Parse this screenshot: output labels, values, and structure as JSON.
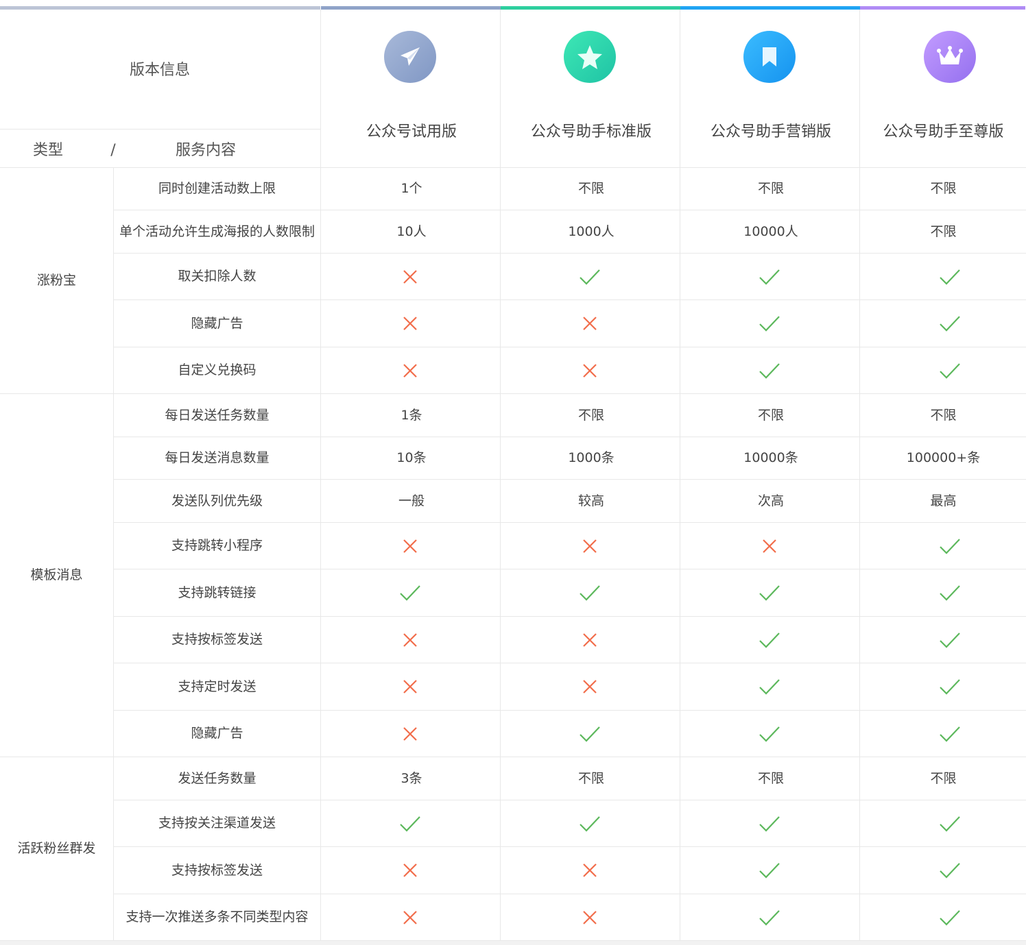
{
  "header": {
    "version_label": "版本信息",
    "type_label": "类型",
    "slash": "/",
    "service_label": "服务内容"
  },
  "plans": [
    {
      "name": "公众号试用版",
      "icon": "paper-plane-icon",
      "bar_color": "#8fa3c8",
      "icon_from": "#a8b9d9",
      "icon_to": "#8097c4"
    },
    {
      "name": "公众号助手标准版",
      "icon": "star-icon",
      "bar_color": "#2ecf9e",
      "icon_from": "#3ee8b5",
      "icon_to": "#1fc3a5"
    },
    {
      "name": "公众号助手营销版",
      "icon": "bookmark-icon",
      "bar_color": "#20a4f3",
      "icon_from": "#3bbcff",
      "icon_to": "#1593ef"
    },
    {
      "name": "公众号助手至尊版",
      "icon": "crown-icon",
      "bar_color": "#b08cf5",
      "icon_from": "#c39cff",
      "icon_to": "#9470ef"
    }
  ],
  "colors": {
    "check": "#5cb85c",
    "cross": "#f26d4b",
    "topbar_left": "#bcc4d6"
  },
  "groups": [
    {
      "name": "涨粉宝",
      "rows": [
        {
          "feature": "同时创建活动数上限",
          "values": [
            "1个",
            "不限",
            "不限",
            "不限"
          ]
        },
        {
          "feature": "单个活动允许生成海报的人数限制",
          "values": [
            "10人",
            "1000人",
            "10000人",
            "不限"
          ]
        },
        {
          "feature": "取关扣除人数",
          "values": [
            "x",
            "v",
            "v",
            "v"
          ]
        },
        {
          "feature": "隐藏广告",
          "values": [
            "x",
            "x",
            "v",
            "v"
          ]
        },
        {
          "feature": "自定义兑换码",
          "values": [
            "x",
            "x",
            "v",
            "v"
          ]
        }
      ]
    },
    {
      "name": "模板消息",
      "rows": [
        {
          "feature": "每日发送任务数量",
          "values": [
            "1条",
            "不限",
            "不限",
            "不限"
          ]
        },
        {
          "feature": "每日发送消息数量",
          "values": [
            "10条",
            "1000条",
            "10000条",
            "100000+条"
          ]
        },
        {
          "feature": "发送队列优先级",
          "values": [
            "一般",
            "较高",
            "次高",
            "最高"
          ]
        },
        {
          "feature": "支持跳转小程序",
          "values": [
            "x",
            "x",
            "x",
            "v"
          ]
        },
        {
          "feature": "支持跳转链接",
          "values": [
            "v",
            "v",
            "v",
            "v"
          ]
        },
        {
          "feature": "支持按标签发送",
          "values": [
            "x",
            "x",
            "v",
            "v"
          ]
        },
        {
          "feature": "支持定时发送",
          "values": [
            "x",
            "x",
            "v",
            "v"
          ]
        },
        {
          "feature": "隐藏广告",
          "values": [
            "x",
            "v",
            "v",
            "v"
          ]
        }
      ]
    },
    {
      "name": "活跃粉丝群发",
      "rows": [
        {
          "feature": "发送任务数量",
          "values": [
            "3条",
            "不限",
            "不限",
            "不限"
          ]
        },
        {
          "feature": "支持按关注渠道发送",
          "values": [
            "v",
            "v",
            "v",
            "v"
          ]
        },
        {
          "feature": "支持按标签发送",
          "values": [
            "x",
            "x",
            "v",
            "v"
          ]
        },
        {
          "feature": "支持一次推送多条不同类型内容",
          "values": [
            "x",
            "x",
            "v",
            "v"
          ]
        }
      ]
    }
  ]
}
